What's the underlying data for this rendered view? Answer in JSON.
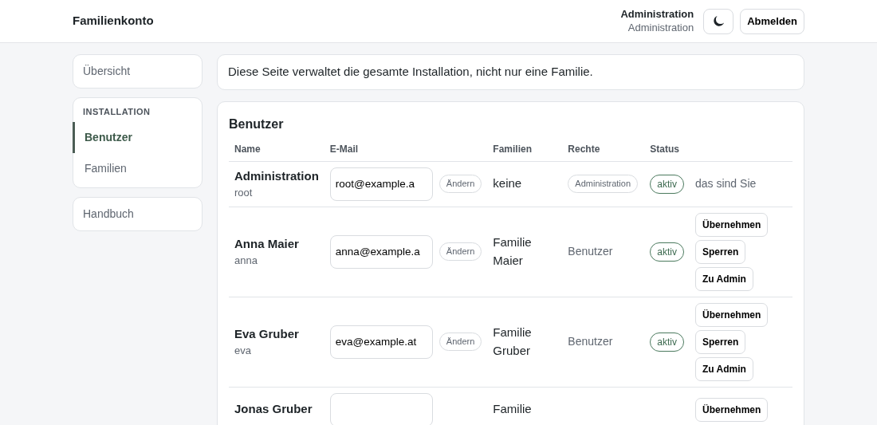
{
  "header": {
    "brand": "Familienkonto",
    "user_name": "Administration",
    "user_role": "Administration",
    "theme_toggle": {
      "kind": "moon"
    },
    "logout": "Abmelden"
  },
  "sidebar": [
    {
      "kind": "link",
      "label": "Übersicht"
    },
    {
      "kind": "section",
      "heading": "INSTALLATION",
      "items": [
        {
          "label": "Benutzer",
          "selected": true
        },
        {
          "label": "Familien",
          "selected": false
        }
      ]
    },
    {
      "kind": "link",
      "label": "Handbuch"
    }
  ],
  "notice": "Diese Seite verwaltet die gesamte Installation, nicht nur eine Familie.",
  "users": {
    "title": "Benutzer",
    "columns": [
      "Name",
      "E-Mail",
      "Familien",
      "Rechte",
      "Status"
    ],
    "rows": [
      {
        "name": "Administration",
        "login": "root",
        "email": "root@example.a",
        "change": "Ändern",
        "families": "keine",
        "rights": {
          "kind": "badge",
          "label": "Administration"
        },
        "status": "aktiv",
        "note": "das sind Sie",
        "actions": []
      },
      {
        "name": "Anna Maier",
        "login": "anna",
        "email": "anna@example.a",
        "change": "Ändern",
        "families": "Familie Maier",
        "rights": {
          "kind": "text",
          "label": "Benutzer"
        },
        "status": "aktiv",
        "actions": [
          "Übernehmen",
          "Sperren",
          "Zu Admin"
        ]
      },
      {
        "name": "Eva Gruber",
        "login": "eva",
        "email": "eva@example.at",
        "change": "Ändern",
        "families": "Familie Gruber",
        "rights": {
          "kind": "text",
          "label": "Benutzer"
        },
        "status": "aktiv",
        "actions": [
          "Übernehmen",
          "Sperren",
          "Zu Admin"
        ]
      },
      {
        "name": "Jonas Gruber",
        "families": "Familie",
        "actions": [
          "Übernehmen"
        ]
      }
    ]
  }
}
